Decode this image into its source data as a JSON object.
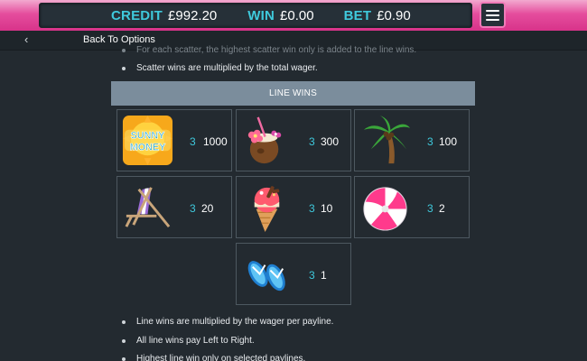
{
  "topbar": {
    "credit_label": "CREDIT",
    "credit_value": "£992.20",
    "win_label": "WIN",
    "win_value": "£0.00",
    "bet_label": "BET",
    "bet_value": "£0.90"
  },
  "nav": {
    "back_icon": "chevron-left-icon",
    "back_label": "Back To Options"
  },
  "content": {
    "cut_line": "For each scatter, the highest scatter win only is added to the line wins.",
    "scatter_note": "Scatter wins are multiplied by the total wager.",
    "section_title": "LINE WINS",
    "symbols": [
      {
        "name": "sunny-money-icon",
        "logo_text": "SUNNY MONEY",
        "count": "3",
        "payout": "1000"
      },
      {
        "name": "coconut-drink-icon",
        "count": "3",
        "payout": "300"
      },
      {
        "name": "palm-tree-icon",
        "count": "3",
        "payout": "100"
      },
      {
        "name": "deck-chair-icon",
        "count": "3",
        "payout": "20"
      },
      {
        "name": "ice-cream-icon",
        "count": "3",
        "payout": "10"
      },
      {
        "name": "beach-ball-icon",
        "count": "3",
        "payout": "2"
      },
      {
        "name": "flip-flops-icon",
        "count": "3",
        "payout": "1"
      }
    ],
    "notes": [
      "Line wins are multiplied by the wager per payline.",
      "All line wins pay Left to Right.",
      "Highest line win only on selected paylines."
    ]
  },
  "colors": {
    "accent_cyan": "#3fc9dc",
    "brand_pink": "#e54d9d",
    "panel_bg": "#263038",
    "header_bg": "#7b8d9c"
  }
}
